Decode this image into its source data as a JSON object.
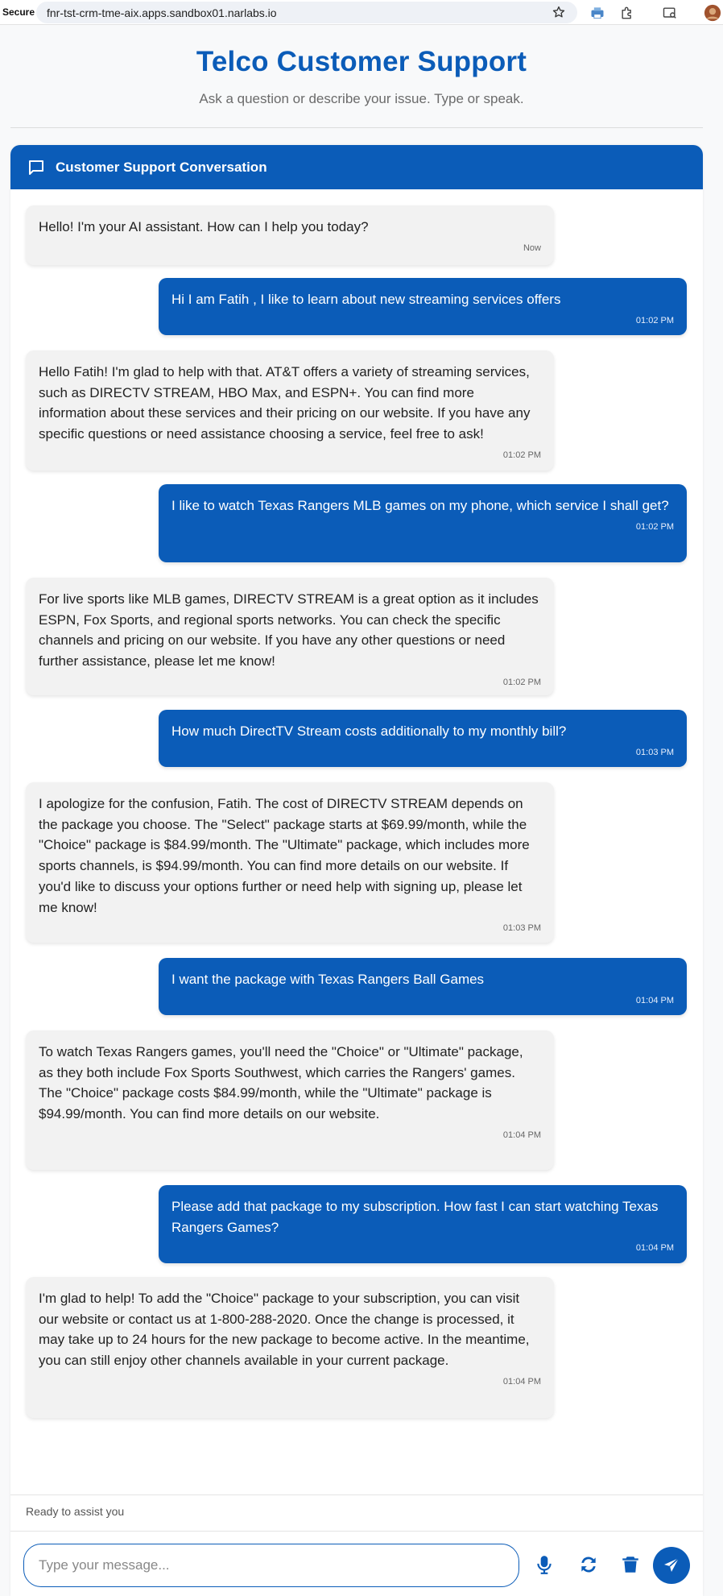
{
  "browser": {
    "secure_label": "Secure",
    "url": "fnr-tst-crm-tme-aix.apps.sandbox01.narlabs.io"
  },
  "header": {
    "title": "Telco Customer Support",
    "subtitle": "Ask a question or describe your issue. Type or speak."
  },
  "panel": {
    "title": "Customer Support Conversation",
    "icon": "chat-icon"
  },
  "messages": [
    {
      "role": "bot",
      "text": "Hello! I'm your AI assistant. How can I help you today?",
      "time": "Now"
    },
    {
      "role": "user",
      "text": "Hi I am Fatih , I like to learn about new streaming services offers",
      "time": "01:02 PM"
    },
    {
      "role": "bot",
      "text": "Hello Fatih! I'm glad to help with that. AT&T offers a variety of streaming services, such as DIRECTV STREAM, HBO Max, and ESPN+. You can find more information about these services and their pricing on our website. If you have any specific questions or need assistance choosing a service, feel free to ask!",
      "time": "01:02 PM"
    },
    {
      "role": "user",
      "text": "I like to watch Texas Rangers MLB games on my phone, which service I shall get?",
      "time": "01:02 PM"
    },
    {
      "role": "bot",
      "text": "For live sports like MLB games, DIRECTV STREAM is a great option as it includes ESPN, Fox Sports, and regional sports networks. You can check the specific channels and pricing on our website. If you have any other questions or need further assistance, please let me know!",
      "time": "01:02 PM"
    },
    {
      "role": "user",
      "text": "How much DirectTV Stream costs additionally to my monthly bill?",
      "time": "01:03 PM"
    },
    {
      "role": "bot",
      "text": "I apologize for the confusion, Fatih. The cost of DIRECTV STREAM depends on the package you choose. The \"Select\" package starts at $69.99/month, while the \"Choice\" package is $84.99/month. The \"Ultimate\" package, which includes more sports channels, is $94.99/month. You can find more details on our website. If you'd like to discuss your options further or need help with signing up, please let me know!",
      "time": "01:03 PM"
    },
    {
      "role": "user",
      "text": "I want the package with Texas Rangers Ball Games",
      "time": "01:04 PM"
    },
    {
      "role": "bot",
      "text": "To watch Texas Rangers games, you'll need the \"Choice\" or \"Ultimate\" package, as they both include Fox Sports Southwest, which carries the Rangers' games. The \"Choice\" package costs $84.99/month, while the \"Ultimate\" package is $94.99/month. You can find more details on our website.",
      "time": "01:04 PM"
    },
    {
      "role": "user",
      "text": "Please add that package to my subscription. How fast I can start watching Texas Rangers Games?",
      "time": "01:04 PM"
    },
    {
      "role": "bot",
      "text": "I'm glad to help! To add the \"Choice\" package to your subscription, you can visit our website or contact us at 1-800-288-2020. Once the change is processed, it may take up to 24 hours for the new package to become active. In the meantime, you can still enjoy other channels available in your current package.",
      "time": "01:04 PM"
    }
  ],
  "status": {
    "text": "Ready to assist you"
  },
  "input": {
    "value": "",
    "placeholder": "Type your message...",
    "icons": [
      "microphone-icon",
      "refresh-icon",
      "trash-icon",
      "send-icon"
    ]
  },
  "colors": {
    "primary": "#0b5cb8",
    "bot_bubble": "#f2f2f2",
    "page_bg": "#f8f9fa"
  }
}
